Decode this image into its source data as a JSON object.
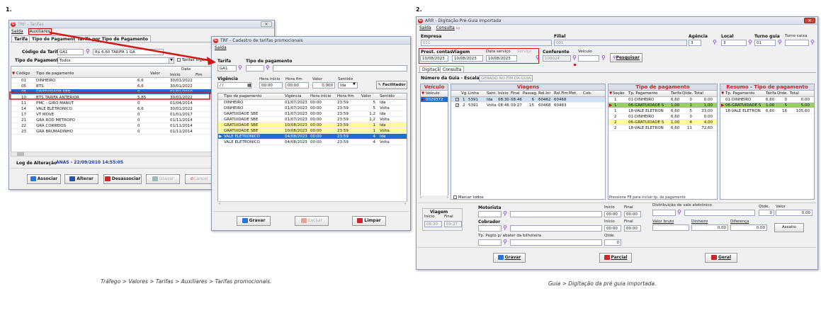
{
  "labels": {
    "one": "1.",
    "two": "2."
  },
  "captions": {
    "left": "Tráfego > Valores > Tarifas > Auxiliares > Tarifas promocionais.",
    "right": "Guia > Digitação da pré guia importada."
  },
  "trf": {
    "title": "TRF - Tarifas",
    "menu": {
      "saida": "Saída",
      "auxiliares": "Auxiliares"
    },
    "tabs": [
      "Tarifa",
      "Tipo de Pagamento",
      "Tarifa por Tipo de Pagamento"
    ],
    "codigo_label": "Código da Tarifa",
    "codigo_value": "GA1",
    "tarifa_value": "R$ 6,60 TARIFA 1 GA",
    "tipo_label": "Tipo de Pagamento",
    "tipo_value": "Todos",
    "tarifas_vigente": "Tarifas Vigente",
    "grid_headers": {
      "codigo": "Código",
      "tipo": "Tipo de pagamento",
      "valor": "Valor",
      "data": "Data",
      "inicio": "Início",
      "fim": "Fim"
    },
    "rows": [
      {
        "codigo": "01",
        "tipo": "DINHEIRO",
        "valor": "6,6",
        "inicio": "30/01/2022"
      },
      {
        "codigo": "05",
        "tipo": "BTS",
        "valor": "6,6",
        "inicio": "30/01/2022"
      },
      {
        "codigo": "06",
        "tipo": "GRATUIDADE SBE",
        "valor": "0",
        "inicio": "01/01/2010"
      },
      {
        "codigo": "10",
        "tipo": "BTS TARIFA ANTERIOR",
        "valor": "5,85",
        "inicio": "30/01/2022"
      },
      {
        "codigo": "11",
        "tipo": "PMC - GIRO MANUT",
        "valor": "0",
        "inicio": "01/04/2014"
      },
      {
        "codigo": "14",
        "tipo": "VALE ELETRONICO",
        "valor": "6,6",
        "inicio": "30/01/2022"
      },
      {
        "codigo": "17",
        "tipo": "VT MOVE",
        "valor": "0",
        "inicio": "01/01/2017"
      },
      {
        "codigo": "21",
        "tipo": "GRA ROD METROPO",
        "valor": "0",
        "inicio": "01/11/2014"
      },
      {
        "codigo": "22",
        "tipo": "GRA CORREIOS",
        "valor": "0",
        "inicio": "01/11/2014"
      },
      {
        "codigo": "23",
        "tipo": "GRA BRUMADINHO",
        "valor": "0",
        "inicio": "01/11/2014"
      }
    ],
    "log_label": "Log de Alteração",
    "log_value": "ANAS - 22/09/2010 14:55:05",
    "buttons": {
      "associar": "Associar",
      "alterar": "Alterar",
      "desassociar": "Desassociar",
      "gravar": "Gravar",
      "cancelar": "Cancel"
    }
  },
  "promo": {
    "title": "TRF - Cadastro de tarifas promocionais",
    "menu_saida": "Saída",
    "tarifa_label": "Tarifa",
    "tarifa_value": "GA1",
    "tipo_label": "Tipo de pagamento",
    "vigencia_label": "Vigência",
    "vigencia_value": " / /",
    "hora_inicio_label": "Hora início",
    "hora_inicio_value": "00:00",
    "hora_fim_label": "Hora fim",
    "hora_fim_value": "00:00",
    "valor_label": "Valor",
    "valor_value": "0,000",
    "sentido_label": "Sentido",
    "sentido_value": "Ida",
    "facilitador": "Facilitador",
    "grid_headers": {
      "tipo": "Tipo de pagamento",
      "vigencia": "Vigência",
      "hora_inicio": "Hora início",
      "hora_fim": "Hora fim",
      "valor": "Valor",
      "sentido": "Sentido"
    },
    "rows": [
      {
        "tipo": "DINHEIRO",
        "vigencia": "01/07/2023",
        "hi": "00:00",
        "hf": "23:59",
        "valor": "5",
        "sentido": "Ida"
      },
      {
        "tipo": "DINHEIRO",
        "vigencia": "01/07/2023",
        "hi": "00:00",
        "hf": "23:59",
        "valor": "5",
        "sentido": "Volta"
      },
      {
        "tipo": "GRATUIDADE SBE",
        "vigencia": "01/07/2023",
        "hi": "00:00",
        "hf": "23:59",
        "valor": "1,2",
        "sentido": "Ida"
      },
      {
        "tipo": "GRATUIDADE SBE",
        "vigencia": "01/07/2023",
        "hi": "00:00",
        "hf": "23:59",
        "valor": "1,2",
        "sentido": "Volta"
      },
      {
        "tipo": "GRATUIDADE SBE",
        "vigencia": "10/08/2023",
        "hi": "00:00",
        "hf": "23:59",
        "valor": "1",
        "sentido": "Ida"
      },
      {
        "tipo": "GRATUIDADE SBE",
        "vigencia": "10/08/2023",
        "hi": "00:00",
        "hf": "23:59",
        "valor": "1",
        "sentido": "Volta"
      },
      {
        "tipo": "VALE ELETRONICO",
        "vigencia": "04/08/2023",
        "hi": "00:00",
        "hf": "23:59",
        "valor": "4",
        "sentido": "Ida"
      },
      {
        "tipo": "VALE ELETRONICO",
        "vigencia": "04/08/2023",
        "hi": "00:00",
        "hf": "23:59",
        "valor": "4",
        "sentido": "Volta"
      }
    ],
    "buttons": {
      "gravar": "Gravar",
      "excluir": "Excluir",
      "limpar": "Limpar"
    }
  },
  "arr": {
    "title": "ARR - Digitação Pré-Guia Importada",
    "menu": {
      "saida": "Saída",
      "consulta": "Consulta"
    },
    "empresa_label": "Empresa",
    "empresa_value": "011",
    "filial_label": "Filial",
    "filial_value": "001",
    "agencia_label": "Agência",
    "agencia_value": "3",
    "local_label": "Local",
    "local_value": "3",
    "turno_label": "Turno guia",
    "turno_value": "01",
    "turno_caixa_label": "Turno caixa",
    "prest_label": "Prest. contas",
    "prest_value": "10/08/2023",
    "viagem_label": "Viagem",
    "viagem_value": "10/08/2023",
    "data_servico_label": "Data serviço",
    "data_servico_value": "10/08/2023",
    "servico_label": "Serviço",
    "conferente_label": "Conferente",
    "conferente_value": "100024",
    "veiculo_label": "Veículo",
    "pesquisar": "Pesquisar",
    "tabs": [
      "Digitação",
      "Consulta"
    ],
    "numero_guia_label": "Número da Guia - Escala:",
    "numero_guia_value": "GERADO NO FIM DA GUIA...",
    "veiculo_section": "Veículo",
    "veiculo_col": "Veículo",
    "veiculo_row": "0029372",
    "viagens_section": "Viagens",
    "viagens_headers": {
      "vg": "Vg.",
      "linha": "Linha",
      "sent": "Sent.",
      "inicio": "Início",
      "final": "Final",
      "passag": "Passag.",
      "rolini": "Rol.Ini",
      "rolfim": "Rol.Fim",
      "mot": "Mot.",
      "cob": "Cob."
    },
    "viagens_rows": [
      {
        "vg": "1",
        "linha": "5391",
        "sent": "Ida",
        "inicio": "08:30",
        "final": "08:46",
        "passag": "6",
        "rolini": "60462",
        "rolfim": "60468"
      },
      {
        "vg": "2",
        "linha": "5391",
        "sent": "Volta",
        "inicio": "08:46",
        "final": "09:27",
        "passag": "15",
        "rolini": "60468",
        "rolfim": "60483"
      }
    ],
    "marcar_todos": "Marcar todos",
    "tipo_section": "Tipo de pagamento",
    "tipo_headers": {
      "secao": "Seção",
      "tp": "Tp. Pagamento",
      "tarifa": "Tarifa",
      "qtde": "Qtde.",
      "total": "Total"
    },
    "tipo_rows": [
      {
        "secao": "1",
        "tp": "01-DINHEIRO",
        "tarifa": "6,60",
        "qtde": "0",
        "total": "0,00"
      },
      {
        "secao": "1",
        "tp": "06-GRATUIDADE S",
        "tarifa": "1,00",
        "qtde": "1",
        "total": "1,00"
      },
      {
        "secao": "1",
        "tp": "18-VALE ELETRON",
        "tarifa": "6,60",
        "qtde": "5",
        "total": "33,00"
      },
      {
        "secao": "2",
        "tp": "01-DINHEIRO",
        "tarifa": "6,60",
        "qtde": "0",
        "total": "0,00"
      },
      {
        "secao": "2",
        "tp": "06-GRATUIDADE S",
        "tarifa": "1,00",
        "qtde": "4",
        "total": "4,00"
      },
      {
        "secao": "2",
        "tp": "18-VALE ELETRON",
        "tarifa": "6,60",
        "qtde": "11",
        "total": "72,60"
      }
    ],
    "f8_hint": "Pressione F8 para incluir tp. de pagamento",
    "resumo_section": "Resumo - Tipo de pagamento",
    "resumo_headers": {
      "tp": "Tp. Pagamento",
      "tarifa": "Tarifa",
      "qtde": "Qtde.",
      "total": "Total"
    },
    "resumo_rows": [
      {
        "tp": "01-DINHEIRO",
        "tarifa": "6,60",
        "qtde": "0",
        "total": "0,00"
      },
      {
        "tp": "06-GRATUIDADE S",
        "tarifa": "1,00",
        "qtde": "5",
        "total": "5,00"
      },
      {
        "tp": "18-VALE ELETRON",
        "tarifa": "6,60",
        "qtde": "16",
        "total": "105,60"
      }
    ],
    "viagem_box_label": "Viagem",
    "inicio_label": "Início",
    "final_label": "Final",
    "vb_inicio": "08:30",
    "vb_final": "09:27",
    "motorista_label": "Motorista",
    "cobrador_label": "Cobrador",
    "m_inicio": "00:00",
    "m_final": "00:00",
    "c_inicio": "00:00",
    "c_final": "00:00",
    "distrib_label": "Distribuição de vale eletrônico",
    "qtde_label": "Qtde.",
    "valor_label": "Valor",
    "qtde_value": "0",
    "valor_value": "0,00",
    "valor_bruto_label": "Valor bruto",
    "dinheiro_label": "Dinheiro",
    "diferenca_label": "Diferença",
    "dinheiro_value": "0,00",
    "diferenca_value": "0,00",
    "assalto": "Assalto",
    "tp_pagto_label": "Tp. Pagto p/ abater da bilhoteira",
    "qtde2_label": "Qtde.",
    "qtde2_value": "0",
    "buttons": {
      "gravar": "Gravar",
      "parcial": "Parcial",
      "geral": "Geral"
    }
  }
}
